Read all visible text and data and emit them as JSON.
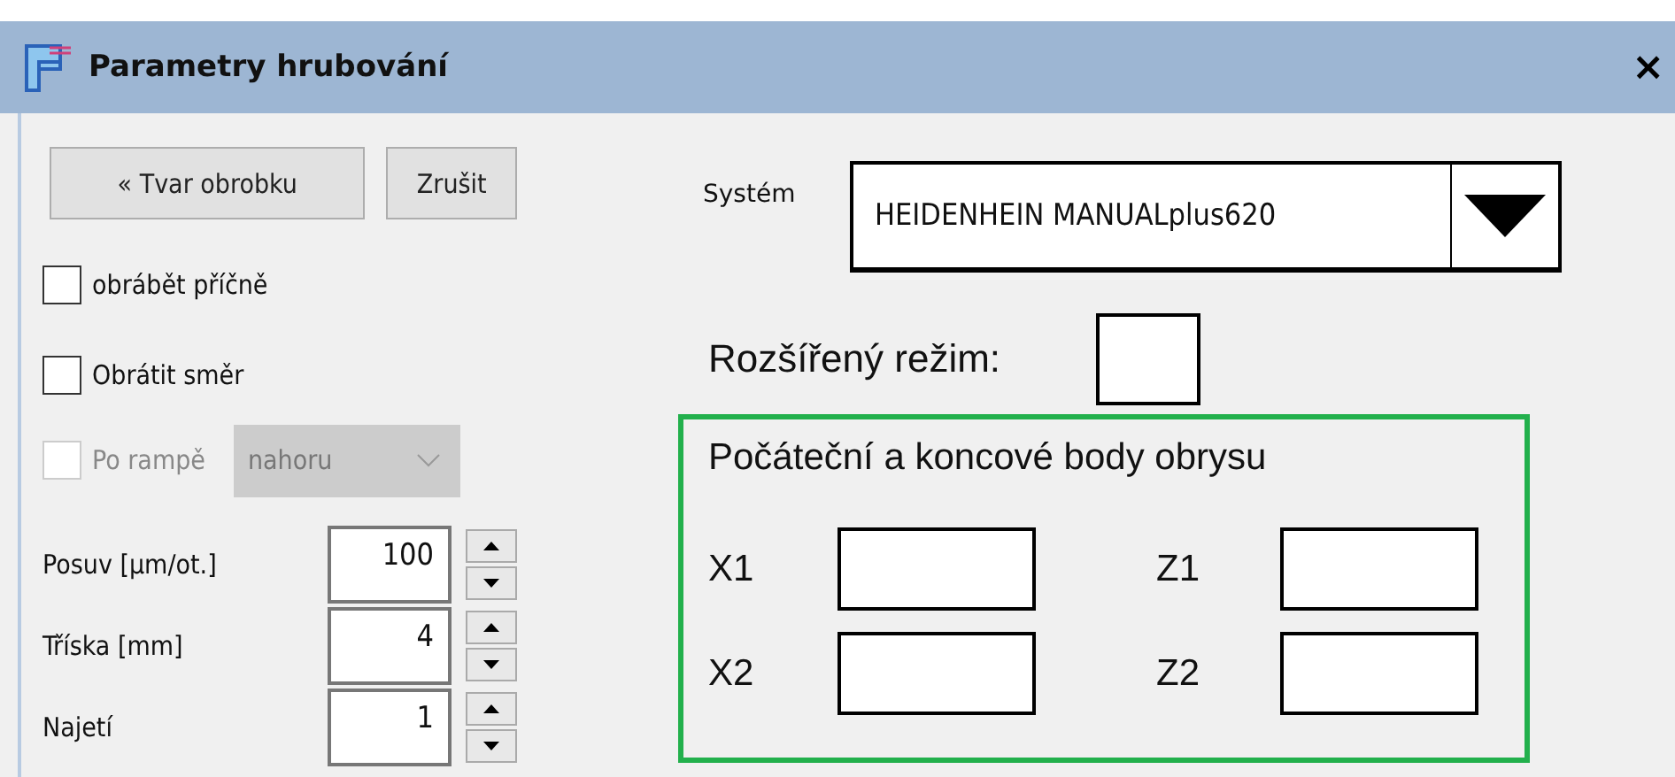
{
  "window": {
    "title": "Parametry hrubování",
    "close": "×"
  },
  "buttons": [
    {
      "label": "« Tvar obrobku"
    },
    {
      "label": "Zrušit"
    }
  ],
  "options": [
    {
      "label": "obrábět příčně",
      "checked": false,
      "disabled": false
    },
    {
      "label": "Obrátit směr",
      "checked": false,
      "disabled": false
    },
    {
      "label": "Po rampě",
      "checked": false,
      "disabled": true,
      "direction": {
        "value": "nahoru",
        "disabled": true
      }
    }
  ],
  "parameters": [
    {
      "label": "Posuv [µm/ot.]",
      "value": "100"
    },
    {
      "label": "Tříska [mm]",
      "value": "4"
    },
    {
      "label": "Najetí",
      "value": "1"
    }
  ],
  "system": {
    "label": "Systém",
    "value": "HEIDENHEIN MANUALplus620"
  },
  "extended_mode": {
    "label": "Rozšířený režim:",
    "checked": false
  },
  "contour_points": {
    "title": "Počáteční a koncové body obrysu",
    "fields": [
      {
        "label": "X1"
      },
      {
        "label": "Z1"
      },
      {
        "label": "X2"
      },
      {
        "label": "Z2"
      }
    ]
  }
}
